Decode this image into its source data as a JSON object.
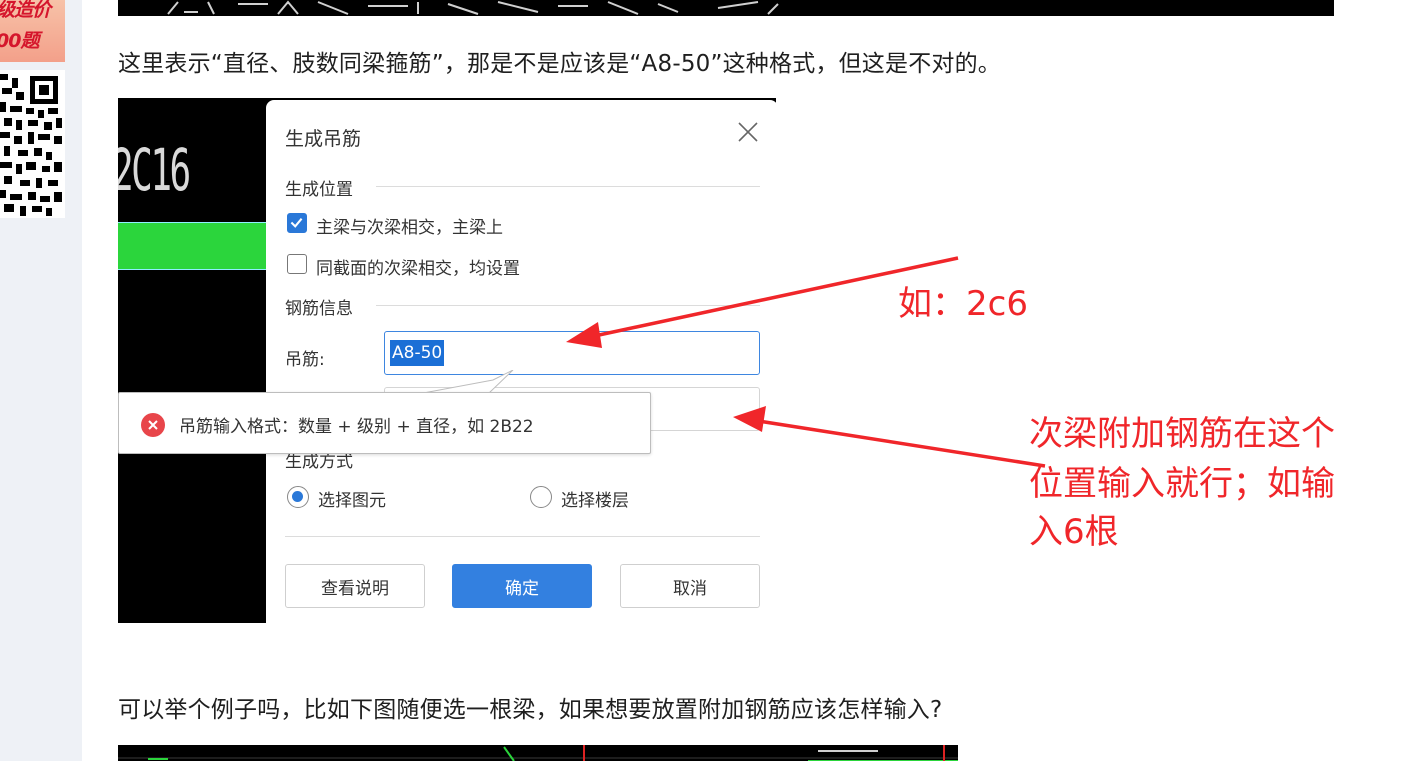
{
  "sidebar": {
    "promo_line1": "级造价",
    "promo_line2": "00题"
  },
  "article": {
    "para1": "这里表示“直径、肢数同梁箍筋”，那是不是应该是“A8-50”这种格式，但这是不对的。",
    "para2": "可以举个例子吗，比如下图随便选一根梁，如果想要放置附加钢筋应该怎样输入?"
  },
  "cad": {
    "text": "2C16"
  },
  "dialog": {
    "title": "生成吊筋",
    "section_position": "生成位置",
    "option_main_beam": "主梁与次梁相交，主梁上",
    "option_same_section": "同截面的次梁相交，均设置",
    "section_rebar": "钢筋信息",
    "hanger_label": "吊筋:",
    "hanger_value": "A8-50",
    "section_method": "生成方式",
    "radio_select_element": "选择图元",
    "radio_select_floor": "选择楼层",
    "btn_help": "查看说明",
    "btn_ok": "确定",
    "btn_cancel": "取消",
    "tooltip": "吊筋输入格式：数量 + 级别 + 直径，如 2B22"
  },
  "annotations": {
    "example": "如：2c6",
    "note_line1": "次梁附加钢筋在这个",
    "note_line2": "位置输入就行；如输",
    "note_line3": "入6根"
  },
  "colors": {
    "annotation": "#f0262a",
    "primary_button": "#3380e0",
    "checkbox": "#2a78d8",
    "error_icon": "#e8454a"
  }
}
